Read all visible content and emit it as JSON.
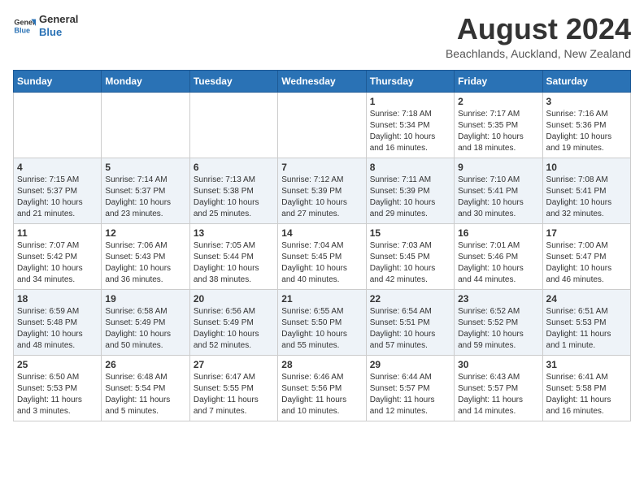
{
  "header": {
    "logo_general": "General",
    "logo_blue": "Blue",
    "month_year": "August 2024",
    "location": "Beachlands, Auckland, New Zealand"
  },
  "weekdays": [
    "Sunday",
    "Monday",
    "Tuesday",
    "Wednesday",
    "Thursday",
    "Friday",
    "Saturday"
  ],
  "weeks": [
    [
      {
        "day": "",
        "info": ""
      },
      {
        "day": "",
        "info": ""
      },
      {
        "day": "",
        "info": ""
      },
      {
        "day": "",
        "info": ""
      },
      {
        "day": "1",
        "info": "Sunrise: 7:18 AM\nSunset: 5:34 PM\nDaylight: 10 hours\nand 16 minutes."
      },
      {
        "day": "2",
        "info": "Sunrise: 7:17 AM\nSunset: 5:35 PM\nDaylight: 10 hours\nand 18 minutes."
      },
      {
        "day": "3",
        "info": "Sunrise: 7:16 AM\nSunset: 5:36 PM\nDaylight: 10 hours\nand 19 minutes."
      }
    ],
    [
      {
        "day": "4",
        "info": "Sunrise: 7:15 AM\nSunset: 5:37 PM\nDaylight: 10 hours\nand 21 minutes."
      },
      {
        "day": "5",
        "info": "Sunrise: 7:14 AM\nSunset: 5:37 PM\nDaylight: 10 hours\nand 23 minutes."
      },
      {
        "day": "6",
        "info": "Sunrise: 7:13 AM\nSunset: 5:38 PM\nDaylight: 10 hours\nand 25 minutes."
      },
      {
        "day": "7",
        "info": "Sunrise: 7:12 AM\nSunset: 5:39 PM\nDaylight: 10 hours\nand 27 minutes."
      },
      {
        "day": "8",
        "info": "Sunrise: 7:11 AM\nSunset: 5:39 PM\nDaylight: 10 hours\nand 29 minutes."
      },
      {
        "day": "9",
        "info": "Sunrise: 7:10 AM\nSunset: 5:41 PM\nDaylight: 10 hours\nand 30 minutes."
      },
      {
        "day": "10",
        "info": "Sunrise: 7:08 AM\nSunset: 5:41 PM\nDaylight: 10 hours\nand 32 minutes."
      }
    ],
    [
      {
        "day": "11",
        "info": "Sunrise: 7:07 AM\nSunset: 5:42 PM\nDaylight: 10 hours\nand 34 minutes."
      },
      {
        "day": "12",
        "info": "Sunrise: 7:06 AM\nSunset: 5:43 PM\nDaylight: 10 hours\nand 36 minutes."
      },
      {
        "day": "13",
        "info": "Sunrise: 7:05 AM\nSunset: 5:44 PM\nDaylight: 10 hours\nand 38 minutes."
      },
      {
        "day": "14",
        "info": "Sunrise: 7:04 AM\nSunset: 5:45 PM\nDaylight: 10 hours\nand 40 minutes."
      },
      {
        "day": "15",
        "info": "Sunrise: 7:03 AM\nSunset: 5:45 PM\nDaylight: 10 hours\nand 42 minutes."
      },
      {
        "day": "16",
        "info": "Sunrise: 7:01 AM\nSunset: 5:46 PM\nDaylight: 10 hours\nand 44 minutes."
      },
      {
        "day": "17",
        "info": "Sunrise: 7:00 AM\nSunset: 5:47 PM\nDaylight: 10 hours\nand 46 minutes."
      }
    ],
    [
      {
        "day": "18",
        "info": "Sunrise: 6:59 AM\nSunset: 5:48 PM\nDaylight: 10 hours\nand 48 minutes."
      },
      {
        "day": "19",
        "info": "Sunrise: 6:58 AM\nSunset: 5:49 PM\nDaylight: 10 hours\nand 50 minutes."
      },
      {
        "day": "20",
        "info": "Sunrise: 6:56 AM\nSunset: 5:49 PM\nDaylight: 10 hours\nand 52 minutes."
      },
      {
        "day": "21",
        "info": "Sunrise: 6:55 AM\nSunset: 5:50 PM\nDaylight: 10 hours\nand 55 minutes."
      },
      {
        "day": "22",
        "info": "Sunrise: 6:54 AM\nSunset: 5:51 PM\nDaylight: 10 hours\nand 57 minutes."
      },
      {
        "day": "23",
        "info": "Sunrise: 6:52 AM\nSunset: 5:52 PM\nDaylight: 10 hours\nand 59 minutes."
      },
      {
        "day": "24",
        "info": "Sunrise: 6:51 AM\nSunset: 5:53 PM\nDaylight: 11 hours\nand 1 minute."
      }
    ],
    [
      {
        "day": "25",
        "info": "Sunrise: 6:50 AM\nSunset: 5:53 PM\nDaylight: 11 hours\nand 3 minutes."
      },
      {
        "day": "26",
        "info": "Sunrise: 6:48 AM\nSunset: 5:54 PM\nDaylight: 11 hours\nand 5 minutes."
      },
      {
        "day": "27",
        "info": "Sunrise: 6:47 AM\nSunset: 5:55 PM\nDaylight: 11 hours\nand 7 minutes."
      },
      {
        "day": "28",
        "info": "Sunrise: 6:46 AM\nSunset: 5:56 PM\nDaylight: 11 hours\nand 10 minutes."
      },
      {
        "day": "29",
        "info": "Sunrise: 6:44 AM\nSunset: 5:57 PM\nDaylight: 11 hours\nand 12 minutes."
      },
      {
        "day": "30",
        "info": "Sunrise: 6:43 AM\nSunset: 5:57 PM\nDaylight: 11 hours\nand 14 minutes."
      },
      {
        "day": "31",
        "info": "Sunrise: 6:41 AM\nSunset: 5:58 PM\nDaylight: 11 hours\nand 16 minutes."
      }
    ]
  ]
}
